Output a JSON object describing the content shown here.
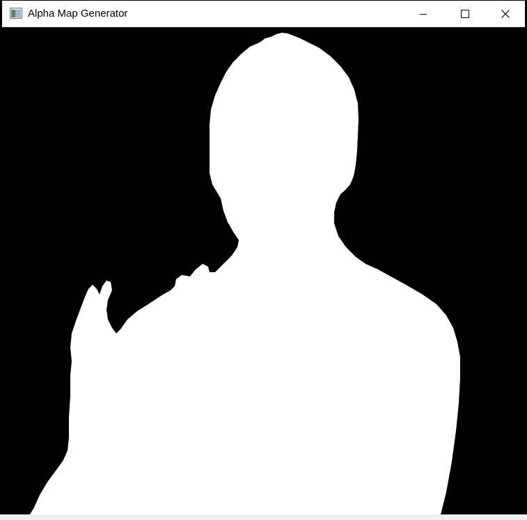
{
  "window": {
    "title": "Alpha Map Generator",
    "icon": "app-window-icon",
    "controls": {
      "minimize": "minimize-icon",
      "maximize": "maximize-icon",
      "close": "close-icon"
    }
  },
  "alpha_map": {
    "foreground_color": "#ffffff",
    "background_color": "#000000"
  },
  "status": {
    "text": ""
  }
}
